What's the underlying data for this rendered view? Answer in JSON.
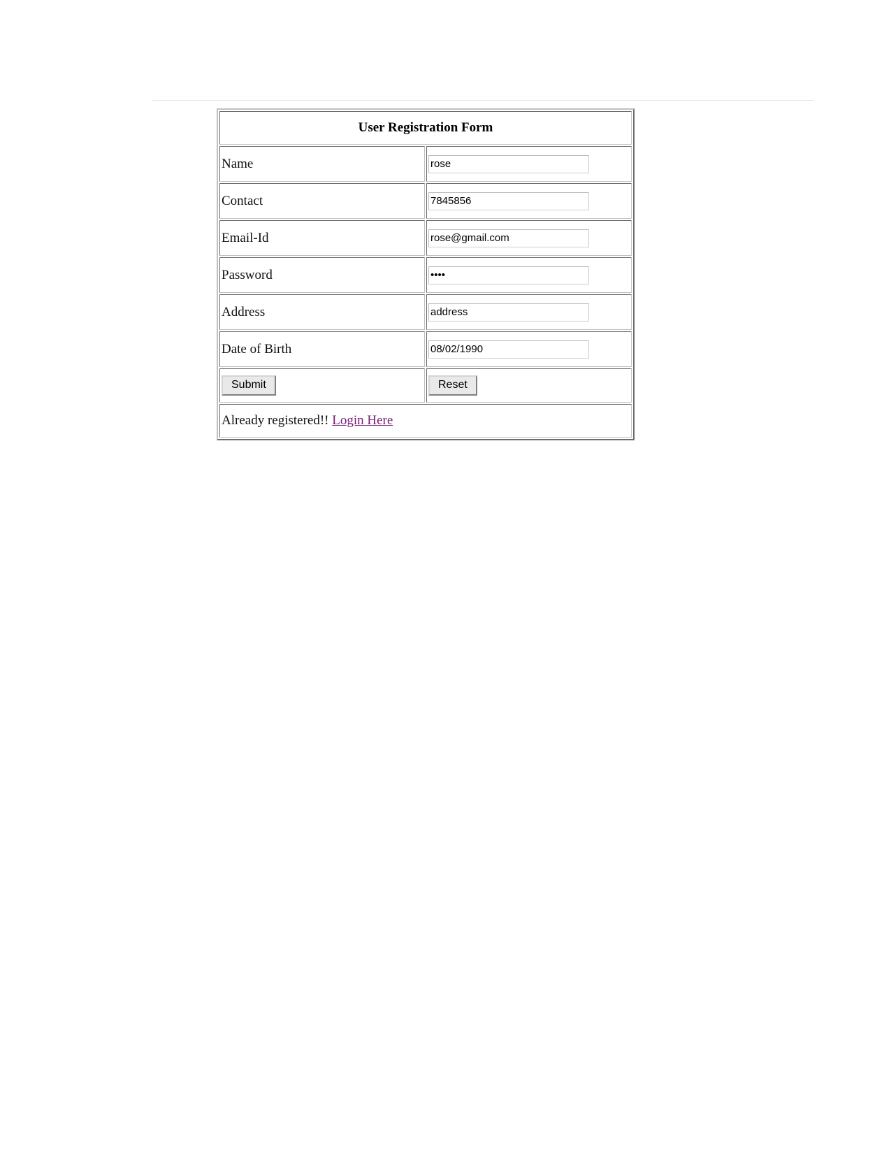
{
  "page": {
    "title": "User Registration Form",
    "link_color": "#781b78",
    "rule_color": "#e3e3e3"
  },
  "form": {
    "heading": "User Registration Form",
    "fields": [
      {
        "label": "Name",
        "name": "name",
        "type": "text",
        "value": "rose",
        "placeholder": ""
      },
      {
        "label": "Contact",
        "name": "contact",
        "type": "text",
        "value": "7845856",
        "placeholder": ""
      },
      {
        "label": "Email-Id",
        "name": "email",
        "type": "text",
        "value": "rose@gmail.com",
        "placeholder": ""
      },
      {
        "label": "Password",
        "name": "password",
        "type": "password",
        "value": "1234",
        "placeholder": ""
      },
      {
        "label": "Address",
        "name": "address",
        "type": "text",
        "value": "address",
        "placeholder": ""
      },
      {
        "label": "Date of Birth",
        "name": "dob",
        "type": "text",
        "value": "08/02/1990",
        "placeholder": ""
      }
    ],
    "buttons": {
      "submit_label": "Submit",
      "reset_label": "Reset"
    },
    "footer": {
      "text": "Already registered!!",
      "link_label": "Login Here"
    }
  }
}
